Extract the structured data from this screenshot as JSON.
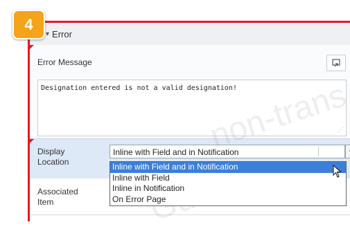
{
  "step_badge": "4",
  "section": {
    "chevron": "▾",
    "title": "Error"
  },
  "error_message": {
    "label": "Error Message",
    "value": "Designation entered is not a valid designation!"
  },
  "display_location": {
    "label_line1": "Display",
    "label_line2": "Location",
    "selected": "Inline with Field and in Notification",
    "options": [
      "Inline with Field and in Notification",
      "Inline with Field",
      "Inline in Notification",
      "On Error Page"
    ]
  },
  "associated_item": {
    "label_line1": "Associated",
    "label_line2": "Item"
  },
  "watermark": {
    "line1": "non-trans",
    "line2": "Guide."
  },
  "colors": {
    "accent_red": "#e8191f",
    "badge_orange": "#f5a31a",
    "selection_blue": "#3c7fd9",
    "row_highlight": "#dde9f7"
  }
}
